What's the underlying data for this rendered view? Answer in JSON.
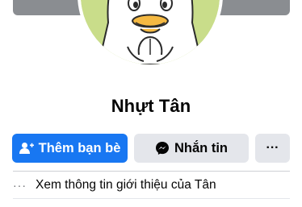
{
  "profile": {
    "name": "Nhựt Tân"
  },
  "actions": {
    "add_friend_label": "Thêm bạn bè",
    "message_label": "Nhắn tin",
    "more_label": "···"
  },
  "about": {
    "dots": "···",
    "label": "Xem thông tin giới thiệu của Tân"
  },
  "icons": {
    "add_friend": "person-plus-icon",
    "messenger": "messenger-icon",
    "more": "more-dots-icon"
  },
  "colors": {
    "primary": "#1877f2",
    "secondary_button": "#e4e6eb",
    "avatar_bg": "#c9dd8a"
  }
}
